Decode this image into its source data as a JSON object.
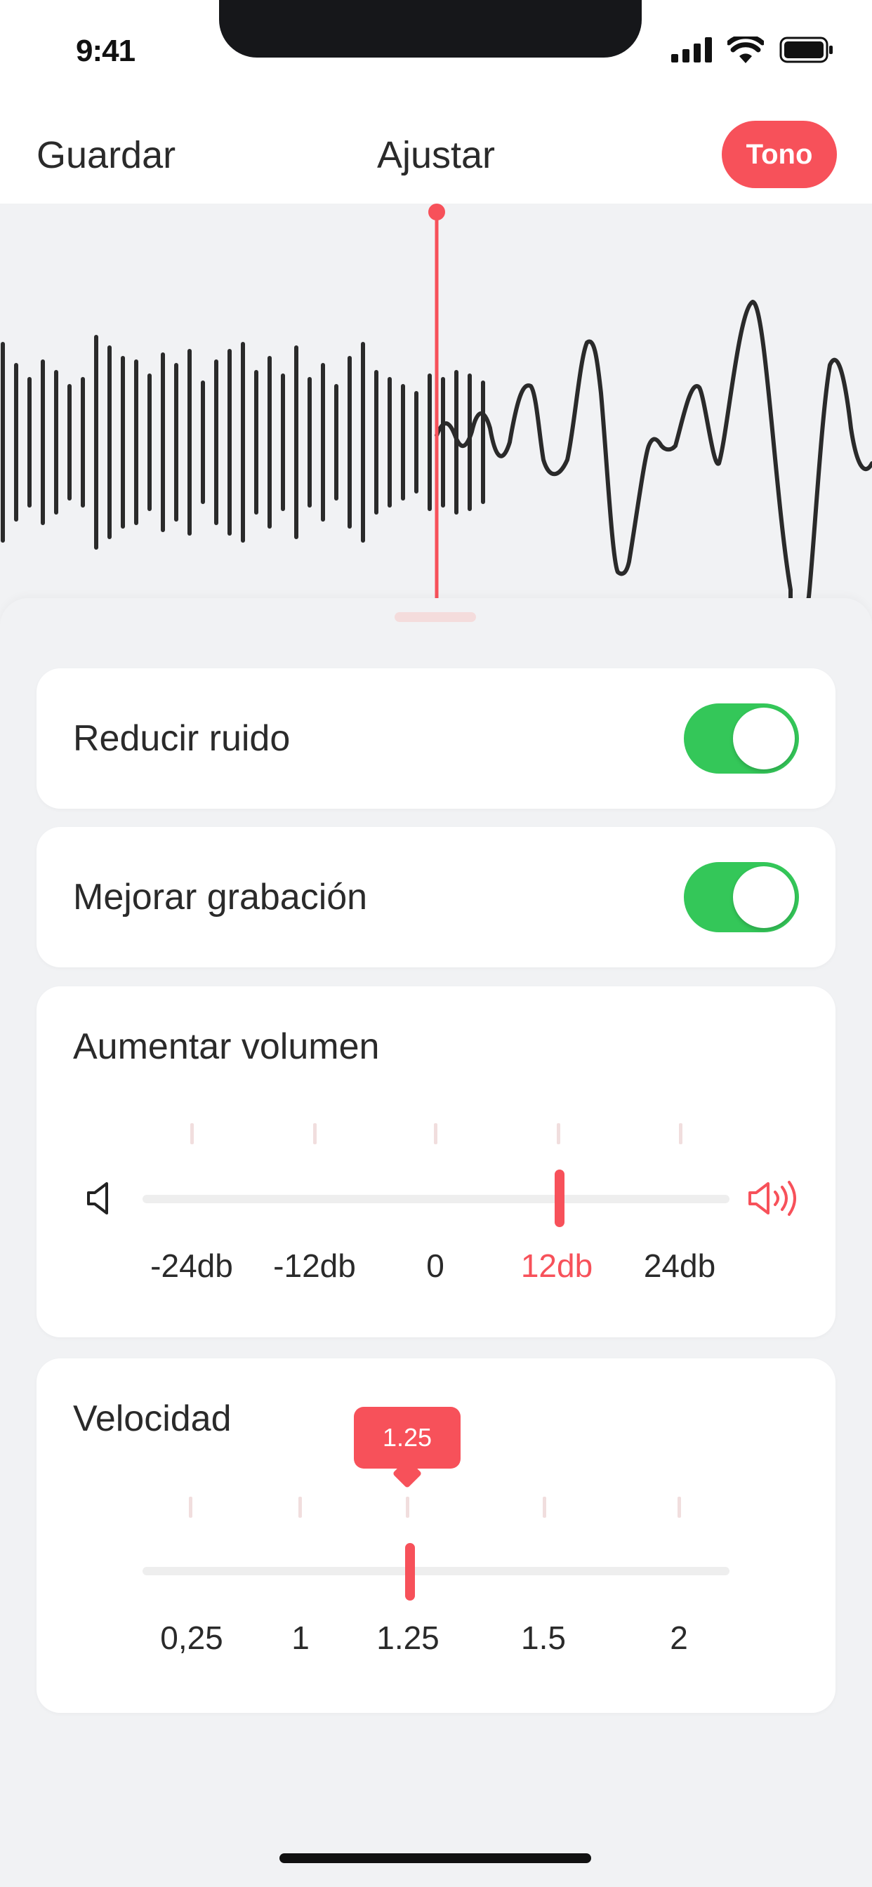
{
  "status_bar": {
    "time": "9:41"
  },
  "nav": {
    "save_label": "Guardar",
    "title": "Ajustar",
    "tone_label": "Tono"
  },
  "settings": {
    "noise_reduction": {
      "label": "Reducir ruido",
      "enabled": true
    },
    "enhance_recording": {
      "label": "Mejorar grabación",
      "enabled": true
    }
  },
  "volume": {
    "label": "Aumentar volumen",
    "options": [
      "-24db",
      "-12db",
      "0",
      "12db",
      "24db"
    ],
    "selected": "12db"
  },
  "speed": {
    "label": "Velocidad",
    "options": [
      "0,25",
      "1",
      "1.25",
      "1.5",
      "2"
    ],
    "selected": "1.25",
    "tooltip": "1.25"
  },
  "colors": {
    "accent": "#f7515a",
    "toggle_on": "#34c759",
    "background": "#f1f2f4"
  }
}
